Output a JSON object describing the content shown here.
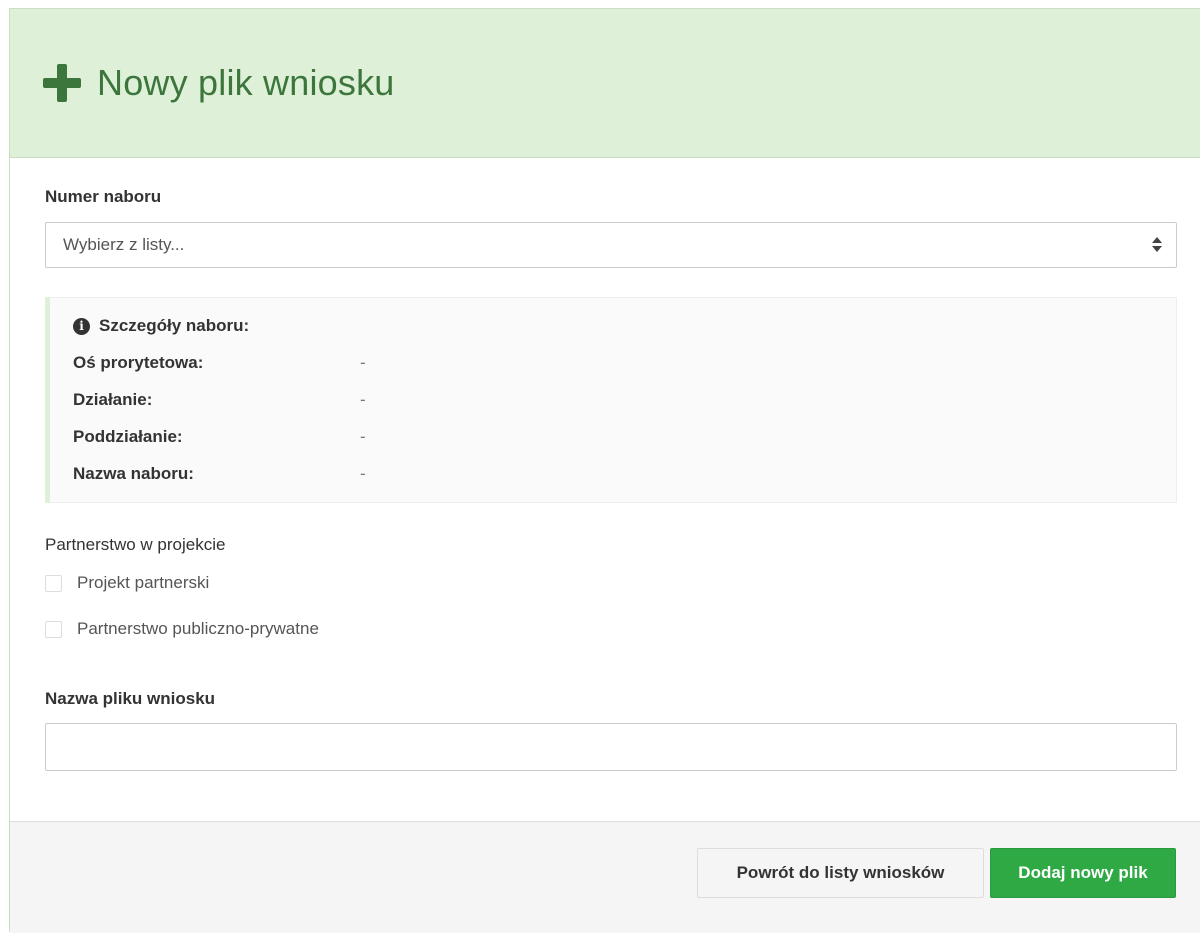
{
  "header": {
    "title": "Nowy plik wniosku",
    "icon": "plus-icon"
  },
  "nabor": {
    "label": "Numer naboru",
    "select_value": "Wybierz z listy..."
  },
  "details": {
    "heading": "Szczegóły naboru:",
    "rows": [
      {
        "label": "Oś prorytetowa:",
        "value": "-"
      },
      {
        "label": "Działanie:",
        "value": "-"
      },
      {
        "label": "Poddziałanie:",
        "value": "-"
      },
      {
        "label": "Nazwa naboru:",
        "value": "-"
      }
    ]
  },
  "partnership": {
    "label": "Partnerstwo w projekcie",
    "options": [
      {
        "label": "Projekt partnerski",
        "checked": false
      },
      {
        "label": "Partnerstwo publiczno-prywatne",
        "checked": false
      }
    ]
  },
  "filename": {
    "label": "Nazwa pliku wniosku",
    "value": ""
  },
  "footer": {
    "back_label": "Powrót do listy wniosków",
    "submit_label": "Dodaj nowy plik"
  },
  "colors": {
    "heading_bg": "#dff0d8",
    "heading_text": "#3c763d",
    "success": "#2ea944"
  }
}
